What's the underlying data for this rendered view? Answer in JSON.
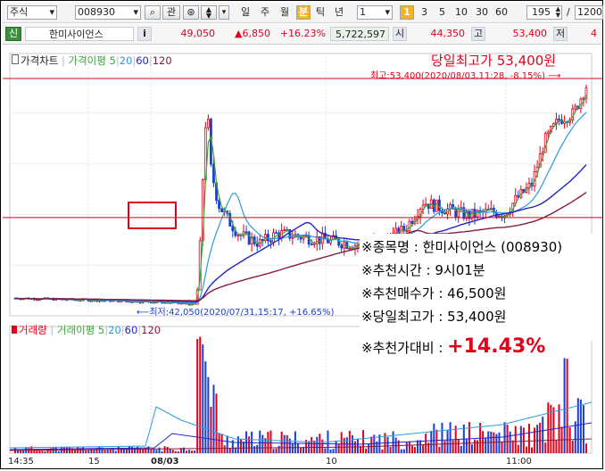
{
  "toolbar": {
    "market": "주식",
    "code": "008930",
    "btn_gwan": "관",
    "periods": [
      "일",
      "주",
      "월",
      "분",
      "틱",
      "년"
    ],
    "selected_period": "분",
    "interval_value": "1",
    "interval_options": [
      "1",
      "3",
      "5",
      "10",
      "30",
      "60"
    ],
    "selected_interval": "1",
    "count_value": "195",
    "slash": "/",
    "total_value": "1200"
  },
  "quote": {
    "badge": "신",
    "name": "한미사이언스",
    "info": "i",
    "price": "49,050",
    "change": "▲6,850",
    "change_pct": "+16.23%",
    "volume": "5,722,597",
    "open_label": "시",
    "open": "44,350",
    "high_label": "고",
    "high": "53,400",
    "low_label": "저",
    "low": "4"
  },
  "price_panel": {
    "title": "가격차트",
    "ma_label": "가격이평",
    "ma_periods": [
      "5",
      "20",
      "60",
      "120"
    ],
    "high_note": "최고:53,400(2020/08/03,11:28, -8.15%)",
    "low_note": "최저:42,050(2020/07/31,15:17, +16.65%)"
  },
  "volume_panel": {
    "title": "거래량",
    "ma_label": "거래이평",
    "ma_periods": [
      "5",
      "20",
      "60",
      "120"
    ]
  },
  "x_axis": [
    "14:35",
    "15",
    "08/03",
    "10",
    "11:00"
  ],
  "overlay": {
    "headline": "당일최고가 53,400원",
    "line1": "※종목명 : 한미사이언스 (008930)",
    "line2": "※추천시간 : 9시01분",
    "line3": "※추천매수가 : 46,500원",
    "line4": "※당일최고가 : 53,400원",
    "line5_label": "※추천가대비 :",
    "line5_value": "+14.43%"
  },
  "colors": {
    "up": "#e3001b",
    "down": "#1a3fd1",
    "ma5": "#3aa43a",
    "ma20": "#2a9be0",
    "ma60": "#2323c8",
    "ma120": "#8b1a3a",
    "selected": "#f7b21d"
  },
  "chart_data": {
    "type": "line",
    "price": {
      "x": [
        "14:35",
        "15",
        "08/03",
        "10",
        "11:00"
      ],
      "close_trend": [
        42400,
        42300,
        42200,
        42100,
        42050,
        50500,
        47000,
        45300,
        45600,
        45200,
        45400,
        45700,
        47000,
        46200,
        46800,
        47300,
        48700,
        50800,
        52400,
        53400
      ],
      "high": 53400,
      "low": 42050,
      "recommend_price": 46500
    }
  }
}
